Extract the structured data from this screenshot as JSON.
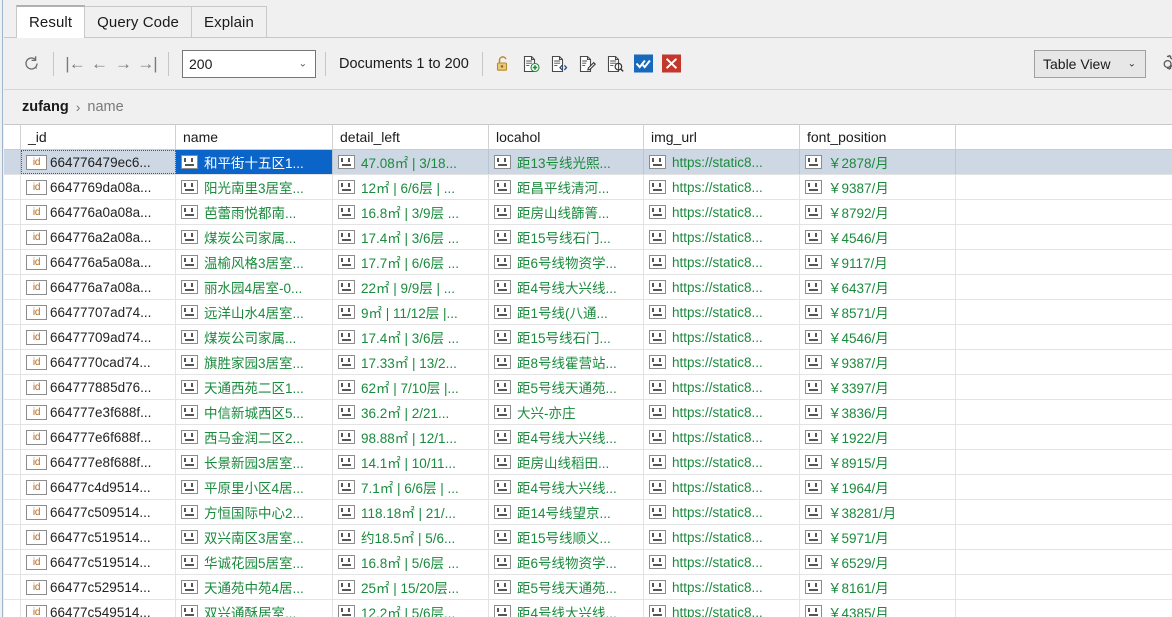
{
  "tabs": [
    {
      "label": "Result",
      "active": true
    },
    {
      "label": "Query Code",
      "active": false
    },
    {
      "label": "Explain",
      "active": false
    }
  ],
  "toolbar": {
    "refresh_title": "Refresh",
    "nav_first": "|←",
    "nav_prev": "←",
    "nav_next": "→",
    "nav_last": "→|",
    "limit_value": "200",
    "limit_caret": "⌄",
    "documents_info": "Documents 1 to 200",
    "view_value": "Table View",
    "view_caret": "⌄",
    "icons": [
      "unlock-icon",
      "insert-document-icon",
      "edit-document-json-icon",
      "edit-document-icon",
      "view-document-icon",
      "apply-changes-icon",
      "discard-changes-icon"
    ],
    "accent_blue": "#1669bb",
    "accent_red": "#c0392b"
  },
  "breadcrumb": {
    "root": "zufang",
    "separator": "›",
    "leaf": "name"
  },
  "table": {
    "columns": [
      "_id",
      "name",
      "detail_left",
      "locahol",
      "img_url",
      "font_position",
      ""
    ],
    "selected_row_index": 0,
    "selected_column": "name",
    "rows": [
      {
        "_id": "664776479ec6...",
        "name": "和平街十五区1...",
        "detail_left": "47.08㎡ | 3/18...",
        "locahol": "距13号线光熙...",
        "img_url": "https://static8...",
        "font_position": "￥2878/月"
      },
      {
        "_id": "6647769da08a...",
        "name": "阳光南里3居室...",
        "detail_left": "12㎡ | 6/6层 | ...",
        "locahol": "距昌平线清河...",
        "img_url": "https://static8...",
        "font_position": "￥9387/月"
      },
      {
        "_id": "664776a0a08a...",
        "name": "芭蕾雨悦都南...",
        "detail_left": "16.8㎡ | 3/9层 ...",
        "locahol": "距房山线篩箐...",
        "img_url": "https://static8...",
        "font_position": "￥8792/月"
      },
      {
        "_id": "664776a2a08a...",
        "name": "煤炭公司家属...",
        "detail_left": "17.4㎡ | 3/6层 ...",
        "locahol": "距15号线石门...",
        "img_url": "https://static8...",
        "font_position": "￥4546/月"
      },
      {
        "_id": "664776a5a08a...",
        "name": "温榆风格3居室...",
        "detail_left": "17.7㎡ | 6/6层 ...",
        "locahol": "距6号线物资学...",
        "img_url": "https://static8...",
        "font_position": "￥9117/月"
      },
      {
        "_id": "664776a7a08a...",
        "name": "丽水园4居室-0...",
        "detail_left": "22㎡ | 9/9层 | ...",
        "locahol": "距4号线大兴线...",
        "img_url": "https://static8...",
        "font_position": "￥6437/月"
      },
      {
        "_id": "66477707ad74...",
        "name": "远洋山水4居室...",
        "detail_left": "9㎡ | 11/12层 |...",
        "locahol": "距1号线(八通...",
        "img_url": "https://static8...",
        "font_position": "￥8571/月"
      },
      {
        "_id": "66477709ad74...",
        "name": "煤炭公司家属...",
        "detail_left": "17.4㎡ | 3/6层 ...",
        "locahol": "距15号线石门...",
        "img_url": "https://static8...",
        "font_position": "￥4546/月"
      },
      {
        "_id": "6647770cad74...",
        "name": "旗胜家园3居室...",
        "detail_left": "17.33㎡ | 13/2...",
        "locahol": "距8号线霍营站...",
        "img_url": "https://static8...",
        "font_position": "￥9387/月"
      },
      {
        "_id": "664777885d76...",
        "name": "天通西苑二区1...",
        "detail_left": "62㎡ | 7/10层 |...",
        "locahol": "距5号线天通苑...",
        "img_url": "https://static8...",
        "font_position": "￥3397/月"
      },
      {
        "_id": "664777e3f688f...",
        "name": "中信新城西区5...",
        "detail_left": "36.2㎡ | 2/21...",
        "locahol": "大兴-亦庄",
        "img_url": "https://static8...",
        "font_position": "￥3836/月"
      },
      {
        "_id": "664777e6f688f...",
        "name": "西马金润二区2...",
        "detail_left": "98.88㎡ | 12/1...",
        "locahol": "距4号线大兴线...",
        "img_url": "https://static8...",
        "font_position": "￥1922/月"
      },
      {
        "_id": "664777e8f688f...",
        "name": "长景新园3居室...",
        "detail_left": "14.1㎡ | 10/11...",
        "locahol": "距房山线稻田...",
        "img_url": "https://static8...",
        "font_position": "￥8915/月"
      },
      {
        "_id": "66477c4d9514...",
        "name": "平原里小区4居...",
        "detail_left": "7.1㎡ | 6/6层 | ...",
        "locahol": "距4号线大兴线...",
        "img_url": "https://static8...",
        "font_position": "￥1964/月"
      },
      {
        "_id": "66477c509514...",
        "name": "方恒国际中心2...",
        "detail_left": "118.18㎡ | 21/...",
        "locahol": "距14号线望京...",
        "img_url": "https://static8...",
        "font_position": "￥38281/月"
      },
      {
        "_id": "66477c519514...",
        "name": "双兴南区3居室...",
        "detail_left": "约18.5㎡ | 5/6...",
        "locahol": "距15号线顺义...",
        "img_url": "https://static8...",
        "font_position": "￥5971/月"
      },
      {
        "_id": "66477c519514...",
        "name": "华诚花园5居室...",
        "detail_left": "16.8㎡ | 5/6层 ...",
        "locahol": "距6号线物资学...",
        "img_url": "https://static8...",
        "font_position": "￥6529/月"
      },
      {
        "_id": "66477c529514...",
        "name": "天通苑中苑4居...",
        "detail_left": "25㎡ | 15/20层...",
        "locahol": "距5号线天通苑...",
        "img_url": "https://static8...",
        "font_position": "￥8161/月"
      },
      {
        "_id": "66477c549514...",
        "name": "双兴通酥居室...",
        "detail_left": "12.2㎡ | 5/6层...",
        "locahol": "距4号线大兴线...",
        "img_url": "https://static8...",
        "font_position": "￥4385/月"
      }
    ]
  }
}
